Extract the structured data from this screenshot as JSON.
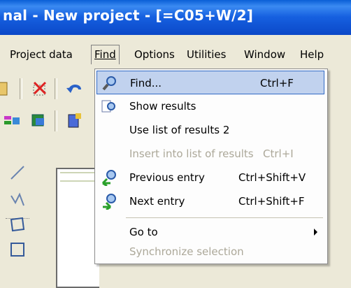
{
  "window": {
    "title": "nal - New project - [=C05+W/2]"
  },
  "menubar": {
    "items": [
      {
        "label": "Project data"
      },
      {
        "label": "Find"
      },
      {
        "label": "Options"
      },
      {
        "label": "Utilities"
      },
      {
        "label": "Window"
      },
      {
        "label": "Help"
      }
    ]
  },
  "find_menu": {
    "items": [
      {
        "label": "Find...",
        "shortcut": "Ctrl+F",
        "icon": "search-icon",
        "enabled": true,
        "highlighted": true
      },
      {
        "label": "Show results",
        "shortcut": "",
        "icon": "results-icon",
        "enabled": true
      },
      {
        "label": "Use list of results 2",
        "shortcut": "",
        "icon": "",
        "enabled": true
      },
      {
        "label": "Insert into list of results",
        "shortcut": "Ctrl+I",
        "icon": "",
        "enabled": false
      },
      {
        "label": "Previous entry",
        "shortcut": "Ctrl+Shift+V",
        "icon": "previous-arrow-icon",
        "enabled": true
      },
      {
        "label": "Next entry",
        "shortcut": "Ctrl+Shift+F",
        "icon": "next-arrow-icon",
        "enabled": true
      },
      {
        "label": "Go to",
        "shortcut": "",
        "icon": "",
        "enabled": true,
        "submenu": true
      },
      {
        "label": "Synchronize selection",
        "shortcut": "",
        "icon": "",
        "enabled": false
      }
    ]
  },
  "colors": {
    "titlebar": "#0b48c8",
    "highlight": "#c1d2ee",
    "highlight_border": "#316ac5",
    "disabled_text": "#aca899"
  }
}
